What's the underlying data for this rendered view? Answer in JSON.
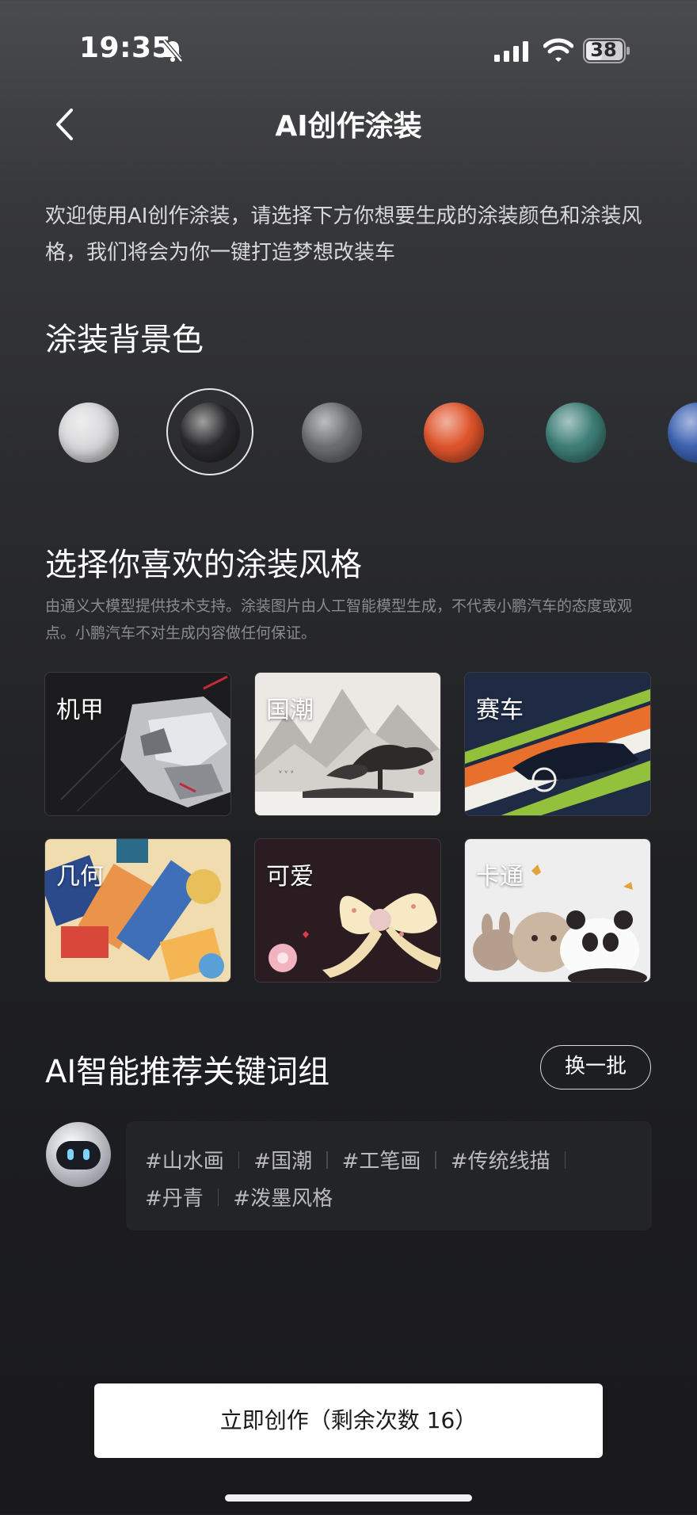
{
  "status_bar": {
    "time": "19:35",
    "battery": "38"
  },
  "header": {
    "title": "AI创作涂装"
  },
  "intro": "欢迎使用AI创作涂装，请选择下方你想要生成的涂装颜色和涂装风格，我们将会为你一键打造梦想改装车",
  "color_section": {
    "title": "涂装背景色",
    "selected_index": 1,
    "swatches": [
      {
        "name": "white",
        "color": "#d9d9db"
      },
      {
        "name": "black",
        "color": "#2b2b2d"
      },
      {
        "name": "gray",
        "color": "#6d6e72"
      },
      {
        "name": "orange",
        "color": "#e0552c"
      },
      {
        "name": "teal",
        "color": "#3f7f78"
      },
      {
        "name": "blue",
        "color": "#3e63b3"
      }
    ]
  },
  "style_section": {
    "title": "选择你喜欢的涂装风格",
    "disclaimer": "由通义大模型提供技术支持。涂装图片由人工智能模型生成，不代表小鹏汽车的态度或观点。小鹏汽车不对生成内容做任何保证。",
    "styles": [
      {
        "label": "机甲"
      },
      {
        "label": "国潮"
      },
      {
        "label": "赛车"
      },
      {
        "label": "几何"
      },
      {
        "label": "可爱"
      },
      {
        "label": "卡通"
      }
    ]
  },
  "keyword_section": {
    "title": "AI智能推荐关键词组",
    "refresh_label": "换一批",
    "row1": [
      "#山水画",
      "#国潮",
      "#工笔画",
      "#传统线描"
    ],
    "row2": [
      "#丹青",
      "#泼墨风格"
    ]
  },
  "cta": {
    "label": "立即创作（剩余次数 16）"
  }
}
